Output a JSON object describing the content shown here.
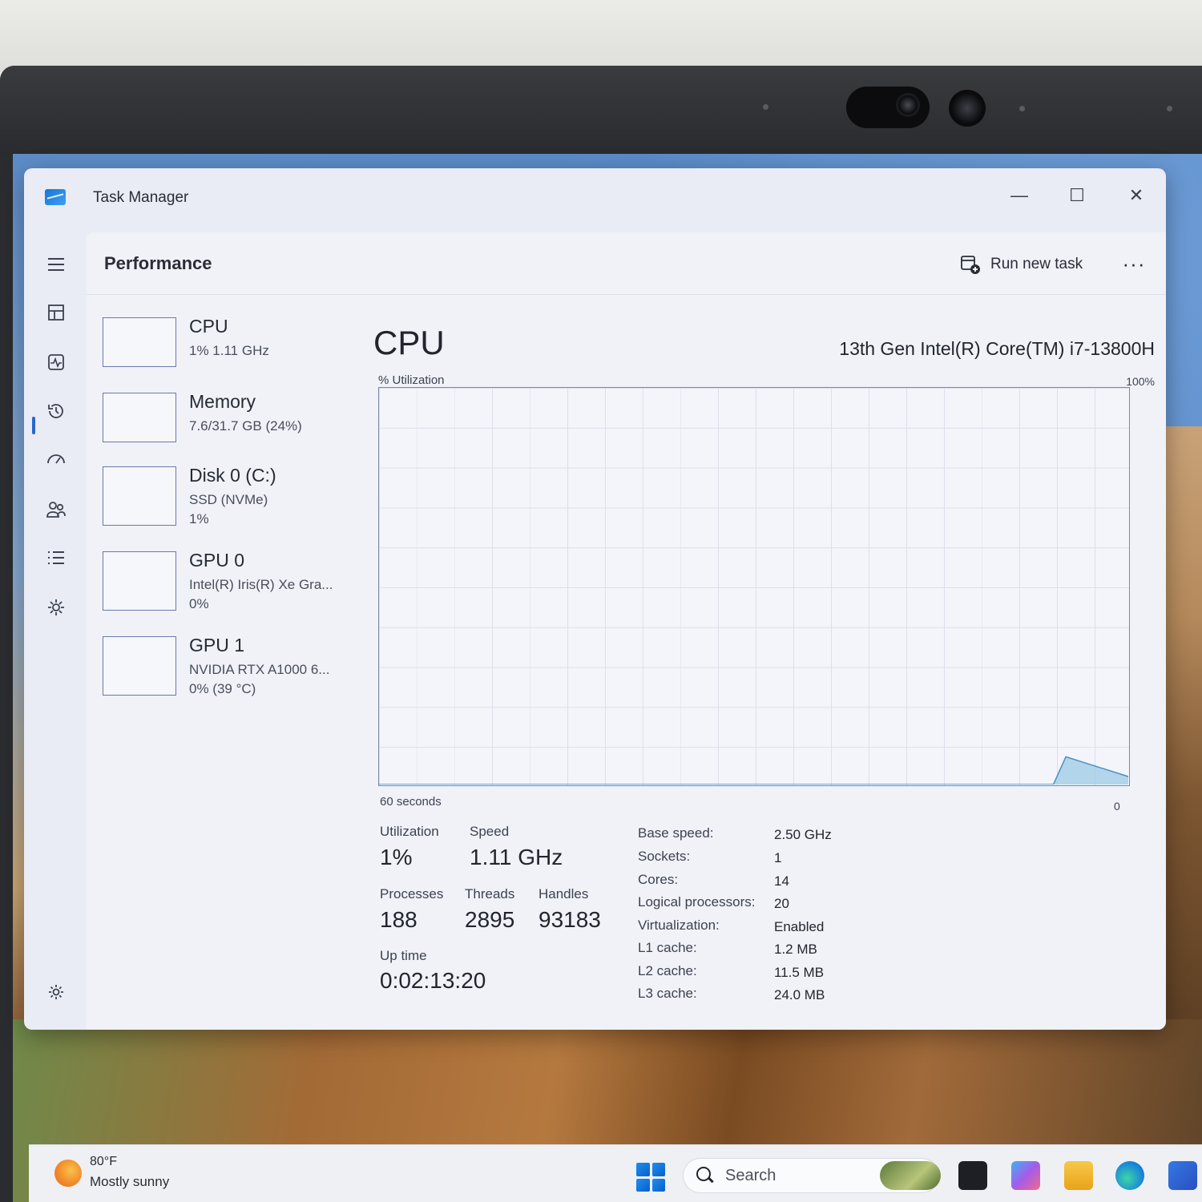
{
  "window": {
    "title": "Task Manager",
    "minimize_glyph": "—",
    "maximize_glyph": "☐",
    "close_glyph": "✕"
  },
  "header": {
    "title": "Performance",
    "run_new_task": "Run new task",
    "more_glyph": "···"
  },
  "nav_rail": [
    {
      "icon": "hamburger-menu-icon",
      "glyph": "☰"
    },
    {
      "icon": "processes-icon",
      "glyph": "▦"
    },
    {
      "icon": "performance-icon",
      "glyph": "⧉",
      "selected": true
    },
    {
      "icon": "app-history-icon",
      "glyph": "↺"
    },
    {
      "icon": "startup-apps-icon",
      "glyph": "⚡"
    },
    {
      "icon": "users-icon",
      "glyph": "👥"
    },
    {
      "icon": "details-icon",
      "glyph": "☷"
    },
    {
      "icon": "services-icon",
      "glyph": "⚙"
    },
    {
      "icon": "settings-icon",
      "glyph": "⚙"
    }
  ],
  "devices": [
    {
      "name": "CPU",
      "line1": "1%  1.11 GHz",
      "line2": ""
    },
    {
      "name": "Memory",
      "line1": "7.6/31.7 GB (24%)",
      "line2": ""
    },
    {
      "name": "Disk 0 (C:)",
      "line1": "SSD (NVMe)",
      "line2": "1%"
    },
    {
      "name": "GPU 0",
      "line1": "Intel(R) Iris(R) Xe Gra...",
      "line2": "0%"
    },
    {
      "name": "GPU 1",
      "line1": "NVIDIA RTX A1000 6...",
      "line2": "0%  (39 °C)"
    }
  ],
  "cpu": {
    "title": "CPU",
    "model": "13th Gen Intel(R) Core(TM) i7-13800H",
    "util_label": "% Utilization",
    "max_label": "100%",
    "time_label": "60 seconds",
    "zero_label": "0",
    "stats": {
      "utilization_label": "Utilization",
      "utilization": "1%",
      "speed_label": "Speed",
      "speed": "1.11 GHz",
      "processes_label": "Processes",
      "processes": "188",
      "threads_label": "Threads",
      "threads": "2895",
      "handles_label": "Handles",
      "handles": "93183",
      "uptime_label": "Up time",
      "uptime": "0:02:13:20"
    },
    "specs": [
      {
        "label": "Base speed:",
        "value": "2.50 GHz"
      },
      {
        "label": "Sockets:",
        "value": "1"
      },
      {
        "label": "Cores:",
        "value": "14"
      },
      {
        "label": "Logical processors:",
        "value": "20"
      },
      {
        "label": "Virtualization:",
        "value": "Enabled"
      },
      {
        "label": "L1 cache:",
        "value": "1.2 MB"
      },
      {
        "label": "L2 cache:",
        "value": "11.5 MB"
      },
      {
        "label": "L3 cache:",
        "value": "24.0 MB"
      }
    ]
  },
  "chart_data": {
    "type": "area",
    "title": "CPU",
    "xlabel": "60 seconds",
    "ylabel": "% Utilization",
    "xlim": [
      60,
      0
    ],
    "ylim": [
      0,
      100
    ],
    "grid": true,
    "series": [
      {
        "x": [
          60,
          59,
          58,
          57,
          56,
          55,
          54,
          53,
          52,
          51,
          50,
          49,
          48,
          47,
          46,
          45,
          44,
          43,
          42,
          41,
          40,
          39,
          38,
          37,
          36,
          35,
          34,
          33,
          32,
          31,
          30,
          29,
          28,
          27,
          26,
          25,
          24,
          23,
          22,
          21,
          20,
          19,
          18,
          17,
          16,
          15,
          14,
          13,
          12,
          11,
          10,
          9,
          8,
          7,
          6,
          5,
          4,
          3,
          2,
          1,
          0
        ],
        "values": [
          0,
          0,
          0,
          0,
          0,
          0,
          0,
          0,
          0,
          0,
          0,
          0,
          0,
          0,
          0,
          0,
          0,
          0,
          0,
          0,
          0,
          0,
          0,
          0,
          0,
          0,
          0,
          0,
          0,
          0,
          0,
          0,
          0,
          0,
          0,
          0,
          0,
          0,
          0,
          0,
          0,
          0,
          0,
          0,
          0,
          0,
          0,
          0,
          0,
          0,
          0,
          0,
          0,
          0,
          0,
          7,
          6,
          5,
          4,
          3,
          2
        ],
        "color": "#9ec9e6"
      }
    ]
  },
  "taskbar": {
    "weather_temp": "80°F",
    "weather_desc": "Mostly sunny",
    "search_text": "Search"
  }
}
